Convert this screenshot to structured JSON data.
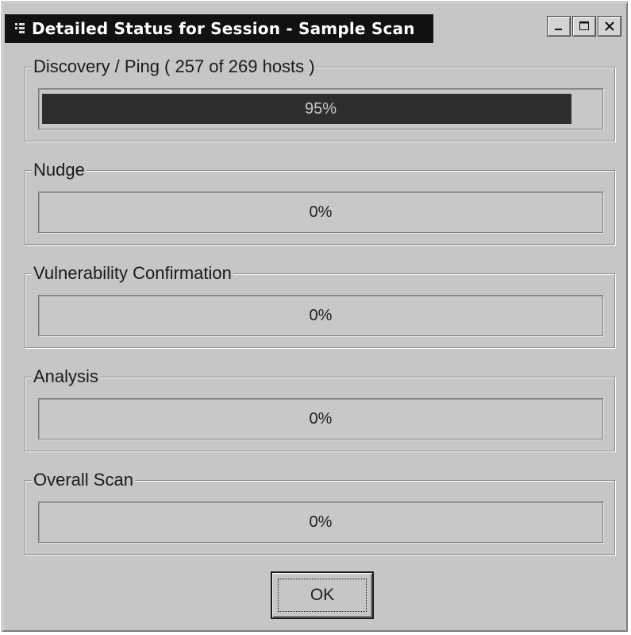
{
  "window": {
    "title": "Detailed Status for Session - Sample Scan",
    "title_buttons": [
      "minimize",
      "maximize",
      "close"
    ]
  },
  "groups": [
    {
      "label": "Discovery / Ping ( 257 of 269 hosts )",
      "progress_text": "95%",
      "progress_fraction": 0.95
    },
    {
      "label": "Nudge",
      "progress_text": "0%",
      "progress_fraction": 0
    },
    {
      "label": "Vulnerability Confirmation",
      "progress_text": "0%",
      "progress_fraction": 0
    },
    {
      "label": "Analysis",
      "progress_text": "0%",
      "progress_fraction": 0
    },
    {
      "label": "Overall Scan",
      "progress_text": "0%",
      "progress_fraction": 0
    }
  ],
  "ok_button": {
    "label": "OK"
  },
  "colors": {
    "dialog_bg": "#c6c6c6",
    "titlebar_bg": "#111111",
    "progress_fill": "#2e2e2e"
  }
}
